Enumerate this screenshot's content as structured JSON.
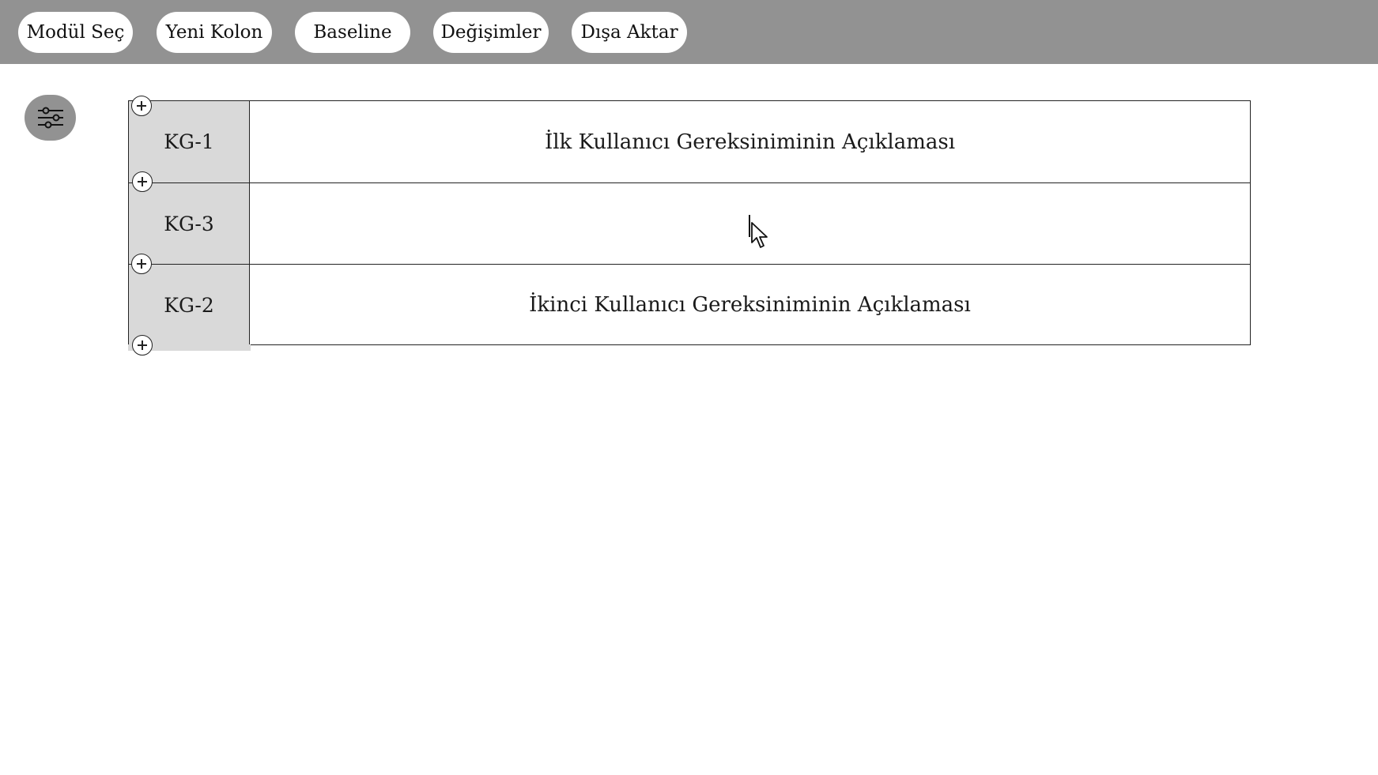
{
  "toolbar": {
    "buttons": [
      {
        "label": "Modül Seç"
      },
      {
        "label": "Yeni Kolon"
      },
      {
        "label": "Baseline"
      },
      {
        "label": "Değişimler"
      },
      {
        "label": "Dışa Aktar"
      }
    ]
  },
  "settings": {
    "icon": "sliders-icon"
  },
  "requirements": {
    "rows": [
      {
        "id": "KG-1",
        "description": "İlk Kullanıcı Gereksiniminin Açıklaması"
      },
      {
        "id": "KG-3",
        "description": ""
      },
      {
        "id": "KG-2",
        "description": "İkinci Kullanıcı Gereksiniminin Açıklaması"
      }
    ],
    "add_icon": "plus-circle-icon"
  },
  "colors": {
    "toolbar_bg": "#929292",
    "id_column_bg": "#d9d9d9",
    "border": "#222222"
  }
}
